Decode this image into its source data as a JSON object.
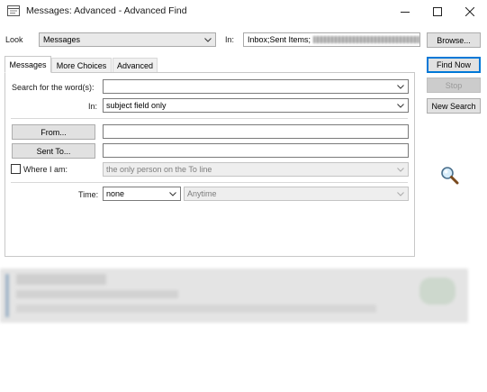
{
  "window": {
    "title": "Messages: Advanced - Advanced Find",
    "minimize_glyph": "—",
    "maximize_glyph": "☐",
    "close_glyph": "✕"
  },
  "look_row": {
    "look_label": "Look",
    "look_value": "Messages",
    "in_label": "In:",
    "in_value": "Inbox;Sent Items;",
    "browse_label": "Browse..."
  },
  "actions": {
    "find_now": "Find Now",
    "stop": "Stop",
    "new_search": "New Search"
  },
  "tabs": [
    {
      "label": "Messages",
      "active": true
    },
    {
      "label": "More Choices",
      "active": false
    },
    {
      "label": "Advanced",
      "active": false
    }
  ],
  "messages_tab": {
    "search_label": "Search for the word(s):",
    "search_value": "",
    "in_label": "In:",
    "in_value": "subject field only",
    "from_button": "From...",
    "from_value": "",
    "sent_to_button": "Sent To...",
    "sent_to_value": "",
    "where_label": "Where I am:",
    "where_checked": false,
    "where_value": "the only person on the To line",
    "time_label": "Time:",
    "time_value": "none",
    "time_range_value": "Anytime"
  },
  "icons": {
    "app": "outlook-find-icon",
    "search": "magnifier-icon",
    "dropdown": "chevron-down-icon"
  },
  "colors": {
    "accent": "#0078d7",
    "panel_border": "#c8c8c8",
    "button_face": "#e1e1e1"
  }
}
